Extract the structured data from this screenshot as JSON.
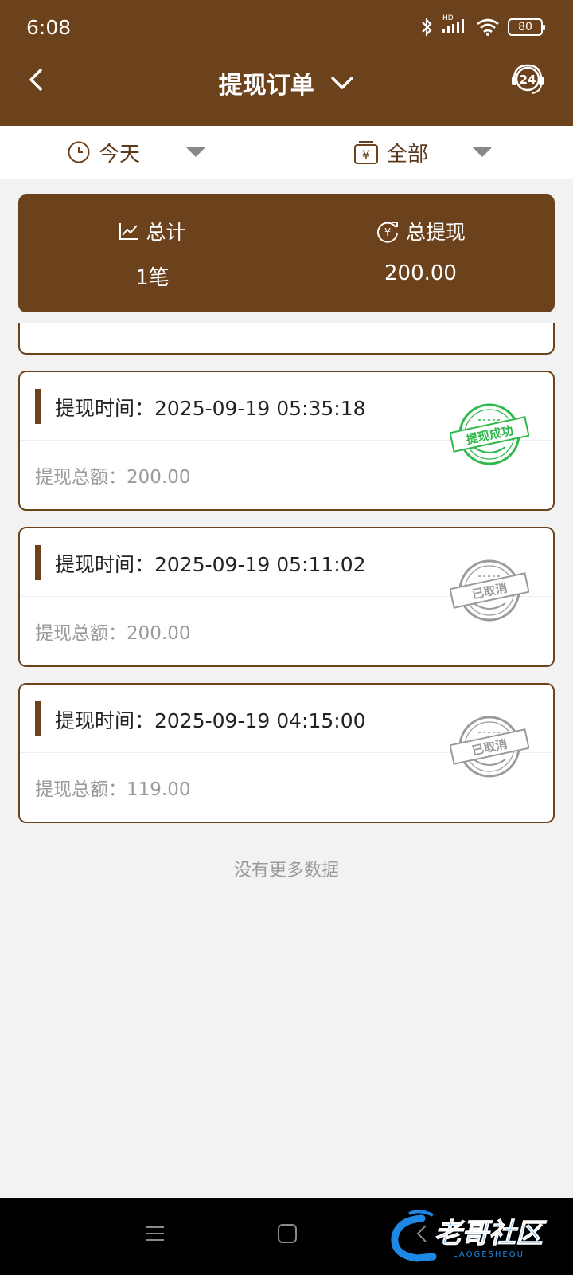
{
  "status_bar": {
    "time": "6:08",
    "battery": "80",
    "hd": "HD"
  },
  "nav": {
    "title": "提现订单"
  },
  "filters": {
    "date": "今天",
    "type": "全部"
  },
  "summary": {
    "total_label": "总计",
    "total_value": "1笔",
    "withdraw_label": "总提现",
    "withdraw_value": "200.00"
  },
  "orders": [
    {
      "time": "提现时间：2025-09-19 05:35:18",
      "amount": "提现总额：200.00",
      "status": "提现成功",
      "status_color": "#2db84a"
    },
    {
      "time": "提现时间：2025-09-19 05:11:02",
      "amount": "提现总额：200.00",
      "status": "已取消",
      "status_color": "#9a9a9a"
    },
    {
      "time": "提现时间：2025-09-19 04:15:00",
      "amount": "提现总额：119.00",
      "status": "已取消",
      "status_color": "#9a9a9a"
    }
  ],
  "footer": {
    "no_more": "没有更多数据"
  },
  "watermark": {
    "main": "老哥社区",
    "sub": "LAOGESHEQU"
  },
  "colors": {
    "brand": "#6b421c",
    "background": "#f2f2f2"
  },
  "icons": {
    "back": "chevron-left-icon",
    "title_dropdown": "chevron-down-icon",
    "support": "headset-24-icon",
    "date_filter": "clock-icon",
    "type_filter": "yuan-wallet-icon",
    "total": "trend-chart-icon",
    "withdraw": "yuan-refresh-icon"
  }
}
